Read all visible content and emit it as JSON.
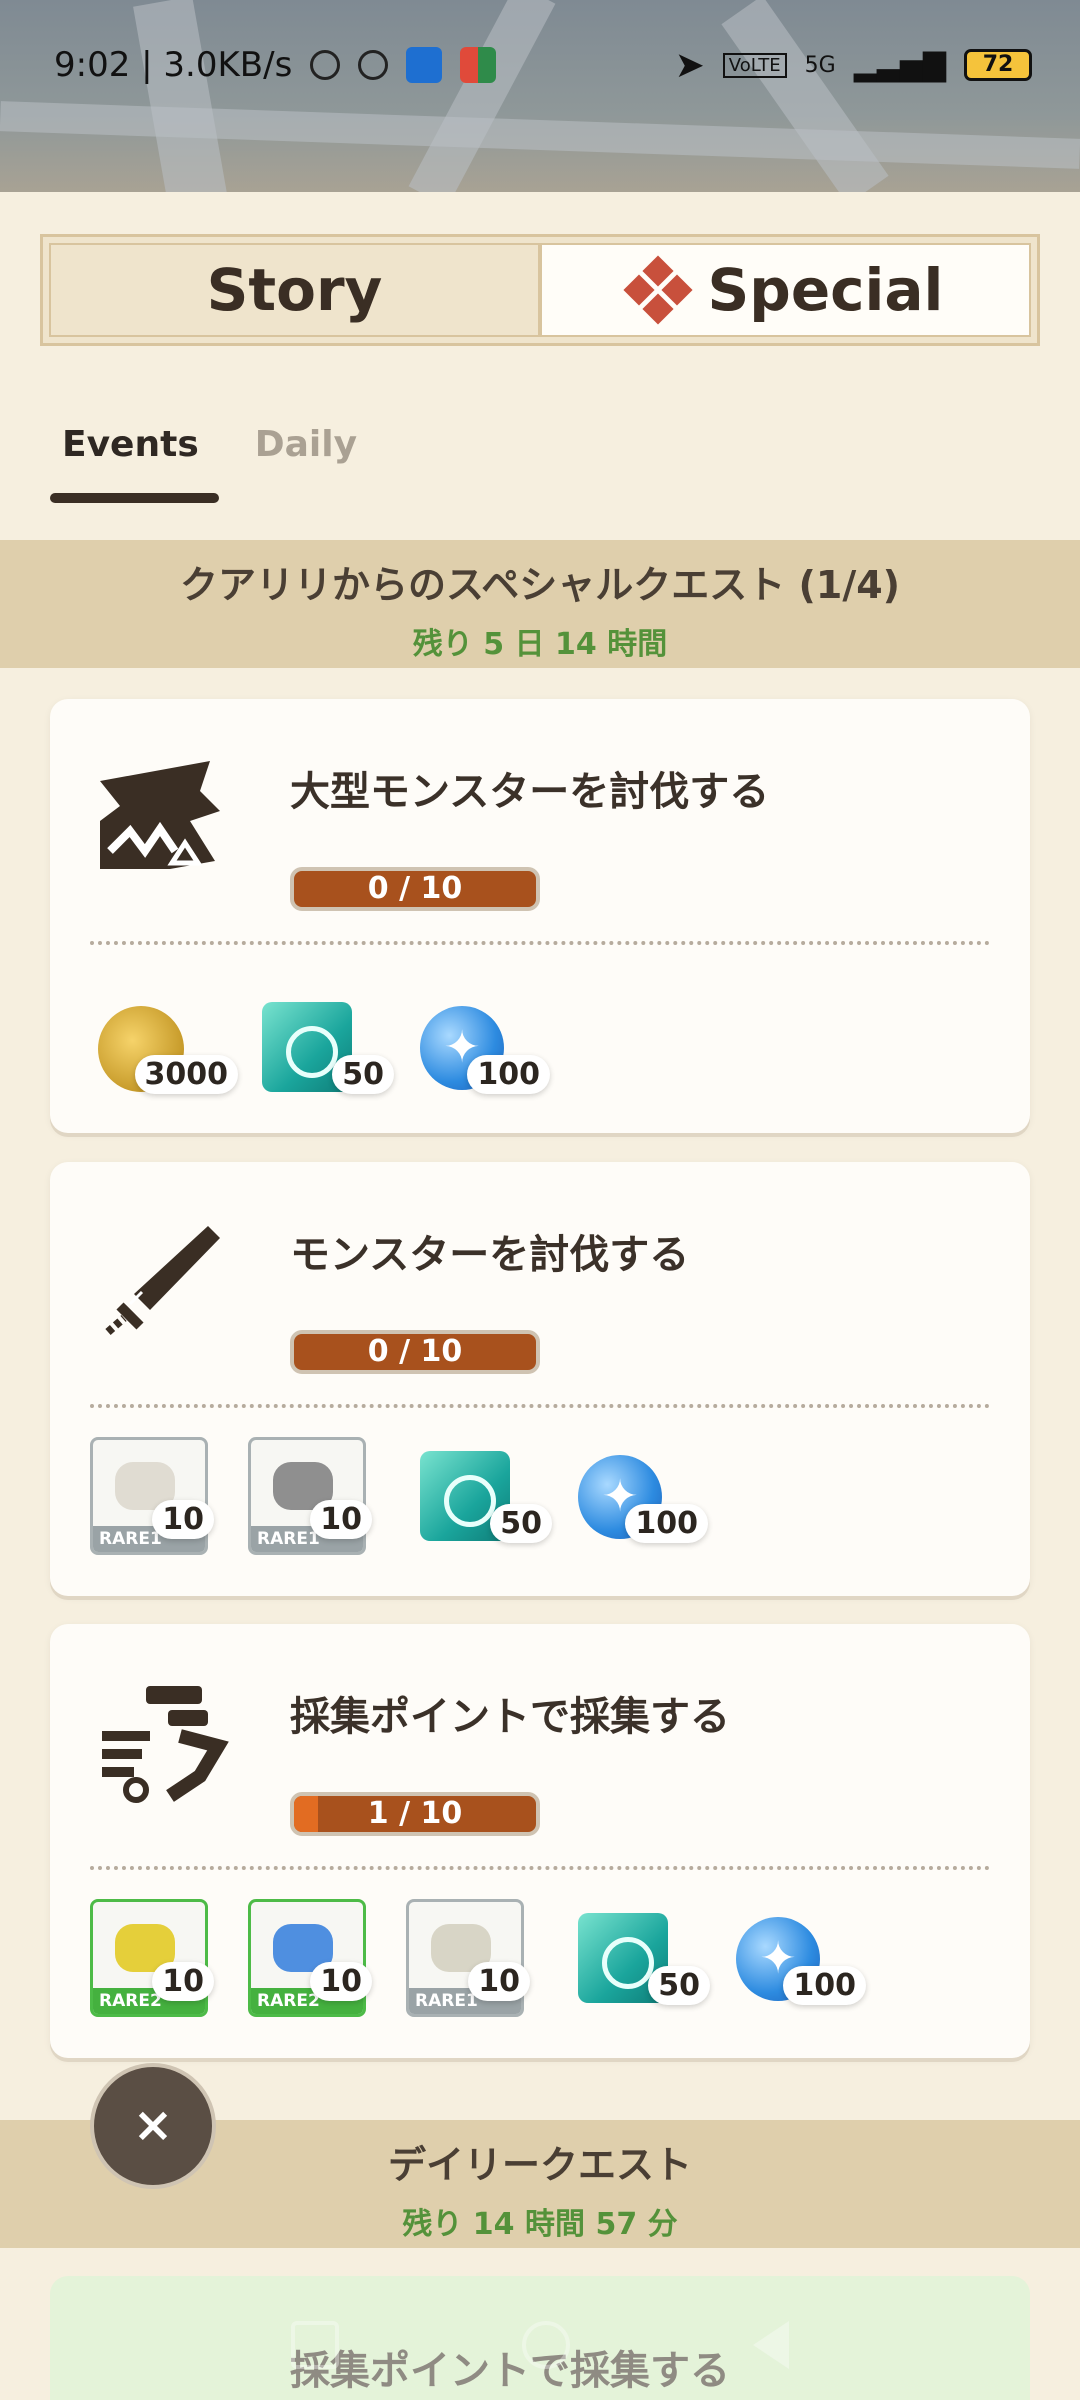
{
  "status": {
    "time_speed": "9:02 | 3.0KB/s",
    "network": "5G",
    "battery": "72"
  },
  "segments": {
    "story": "Story",
    "special": "Special"
  },
  "subtabs": {
    "events": "Events",
    "daily": "Daily"
  },
  "special_section": {
    "title": "クアリリからのスペシャルクエスト (1/4)",
    "time_left": "残り 5 日 14 時間"
  },
  "quests": [
    {
      "title": "大型モンスターを討伐する",
      "progress_text": "0 / 10",
      "progress": 0.0,
      "rewards": [
        {
          "type": "coin",
          "count": "3000"
        },
        {
          "type": "gem",
          "count": "50"
        },
        {
          "type": "orb",
          "count": "100"
        }
      ]
    },
    {
      "title": "モンスターを討伐する",
      "progress_text": "0 / 10",
      "progress": 0.0,
      "rewards": [
        {
          "type": "material",
          "rarity": "RARE1",
          "count": "10"
        },
        {
          "type": "material",
          "rarity": "RARE1",
          "count": "10"
        },
        {
          "type": "gem",
          "count": "50"
        },
        {
          "type": "orb",
          "count": "100"
        }
      ]
    },
    {
      "title": "採集ポイントで採集する",
      "progress_text": "1 / 10",
      "progress": 0.1,
      "rewards": [
        {
          "type": "material",
          "rarity": "RARE2",
          "count": "10"
        },
        {
          "type": "material",
          "rarity": "RARE2",
          "count": "10"
        },
        {
          "type": "material",
          "rarity": "RARE1",
          "count": "10"
        },
        {
          "type": "gem",
          "count": "50"
        },
        {
          "type": "orb",
          "count": "100"
        }
      ]
    }
  ],
  "daily_section": {
    "title": "デイリークエスト",
    "time_left": "残り 14 時間 57 分"
  },
  "peek_quest": {
    "title": "採集ポイントで採集する"
  },
  "close_label": "×",
  "colors": {
    "accent_green": "#54923a",
    "progress_bar": "#a8511d",
    "progress_fill": "#e26c22",
    "banner_bg": "#dfcfac",
    "special_icon": "#c8503c"
  }
}
